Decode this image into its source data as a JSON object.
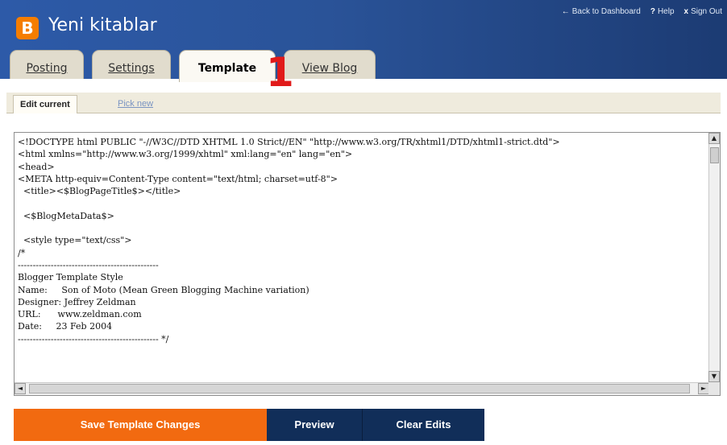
{
  "header": {
    "logo_letter": "B",
    "blog_title": "Yeni kitablar",
    "links": {
      "back": "Back to Dashboard",
      "help": "Help",
      "signout": "Sign Out"
    }
  },
  "tabs": {
    "posting": "Posting",
    "settings": "Settings",
    "template": "Template",
    "viewblog": "View Blog"
  },
  "annotation": {
    "number": "1"
  },
  "subtabs": {
    "edit_current": "Edit current",
    "pick_new": "Pick new"
  },
  "editor": {
    "code": "<!DOCTYPE html PUBLIC \"-//W3C//DTD XHTML 1.0 Strict//EN\" \"http://www.w3.org/TR/xhtml1/DTD/xhtml1-strict.dtd\">\n<html xmlns=\"http://www.w3.org/1999/xhtml\" xml:lang=\"en\" lang=\"en\">\n<head>\n<META http-equiv=Content-Type content=\"text/html; charset=utf-8\">\n  <title><$BlogPageTitle$></title>\n\n  <$BlogMetaData$>\n\n  <style type=\"text/css\">\n/*\n-----------------------------------------------\nBlogger Template Style\nName:     Son of Moto (Mean Green Blogging Machine variation)\nDesigner: Jeffrey Zeldman\nURL:      www.zeldman.com\nDate:     23 Feb 2004\n----------------------------------------------- */"
  },
  "buttons": {
    "save": "Save Template Changes",
    "preview": "Preview",
    "clear": "Clear Edits"
  },
  "colors": {
    "header_bg": "#2a5398",
    "logo_orange": "#f57d00",
    "save_orange": "#f26a10",
    "dark_button": "#112e59",
    "annotation_red": "#e11a1a"
  }
}
